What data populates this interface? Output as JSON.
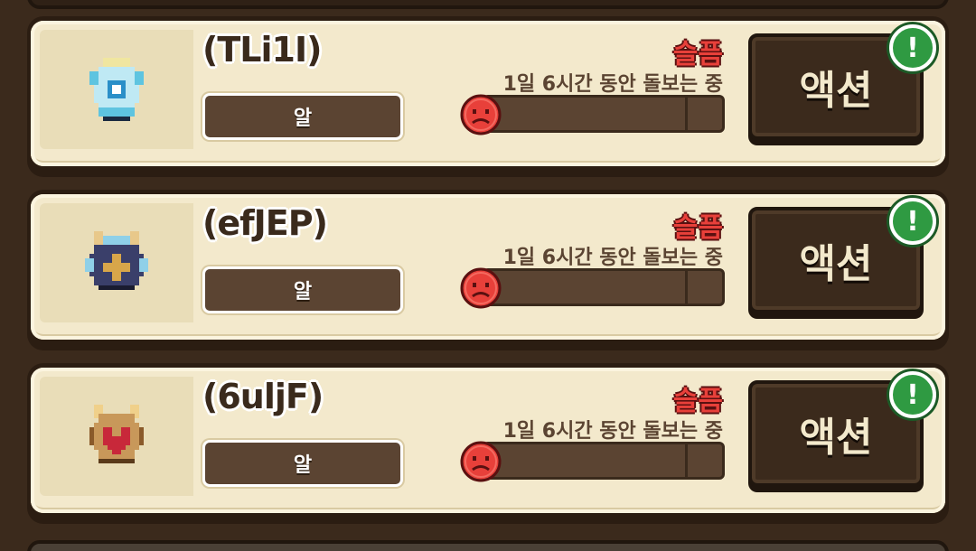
{
  "pets": [
    {
      "name": "(TLi1I)",
      "type": "알",
      "mood": "슬픔",
      "care_time": "1일 6시간 동안 돌보는 중",
      "action_label": "액션",
      "alert_symbol": "!",
      "icon": "egg-ice-crystal-icon",
      "colors": {
        "shell": "#bfe9f4",
        "accent": "#5ec4e0",
        "core": "#2a8fc8"
      }
    },
    {
      "name": "(efJEP)",
      "type": "알",
      "mood": "슬픔",
      "care_time": "1일 6시간 동안 돌보는 중",
      "action_label": "액션",
      "alert_symbol": "!",
      "icon": "egg-dark-horned-icon",
      "colors": {
        "shell": "#3a3f6a",
        "accent": "#8fd0e8",
        "core": "#d8a64a"
      }
    },
    {
      "name": "(6uljF)",
      "type": "알",
      "mood": "슬픔",
      "care_time": "1일 6시간 동안 돌보는 중",
      "action_label": "액션",
      "alert_symbol": "!",
      "icon": "egg-golden-heart-icon",
      "colors": {
        "shell": "#c8985a",
        "accent": "#f0d08a",
        "core": "#c8283a"
      }
    }
  ],
  "gauge": {
    "level": 0.0,
    "color": "#e8403a",
    "mood_icon": "sad-face-icon"
  },
  "theme": {
    "alert_green": "#2f9a42",
    "card_bg": "#f3e9cc",
    "button_bg": "#3b2a1c"
  }
}
